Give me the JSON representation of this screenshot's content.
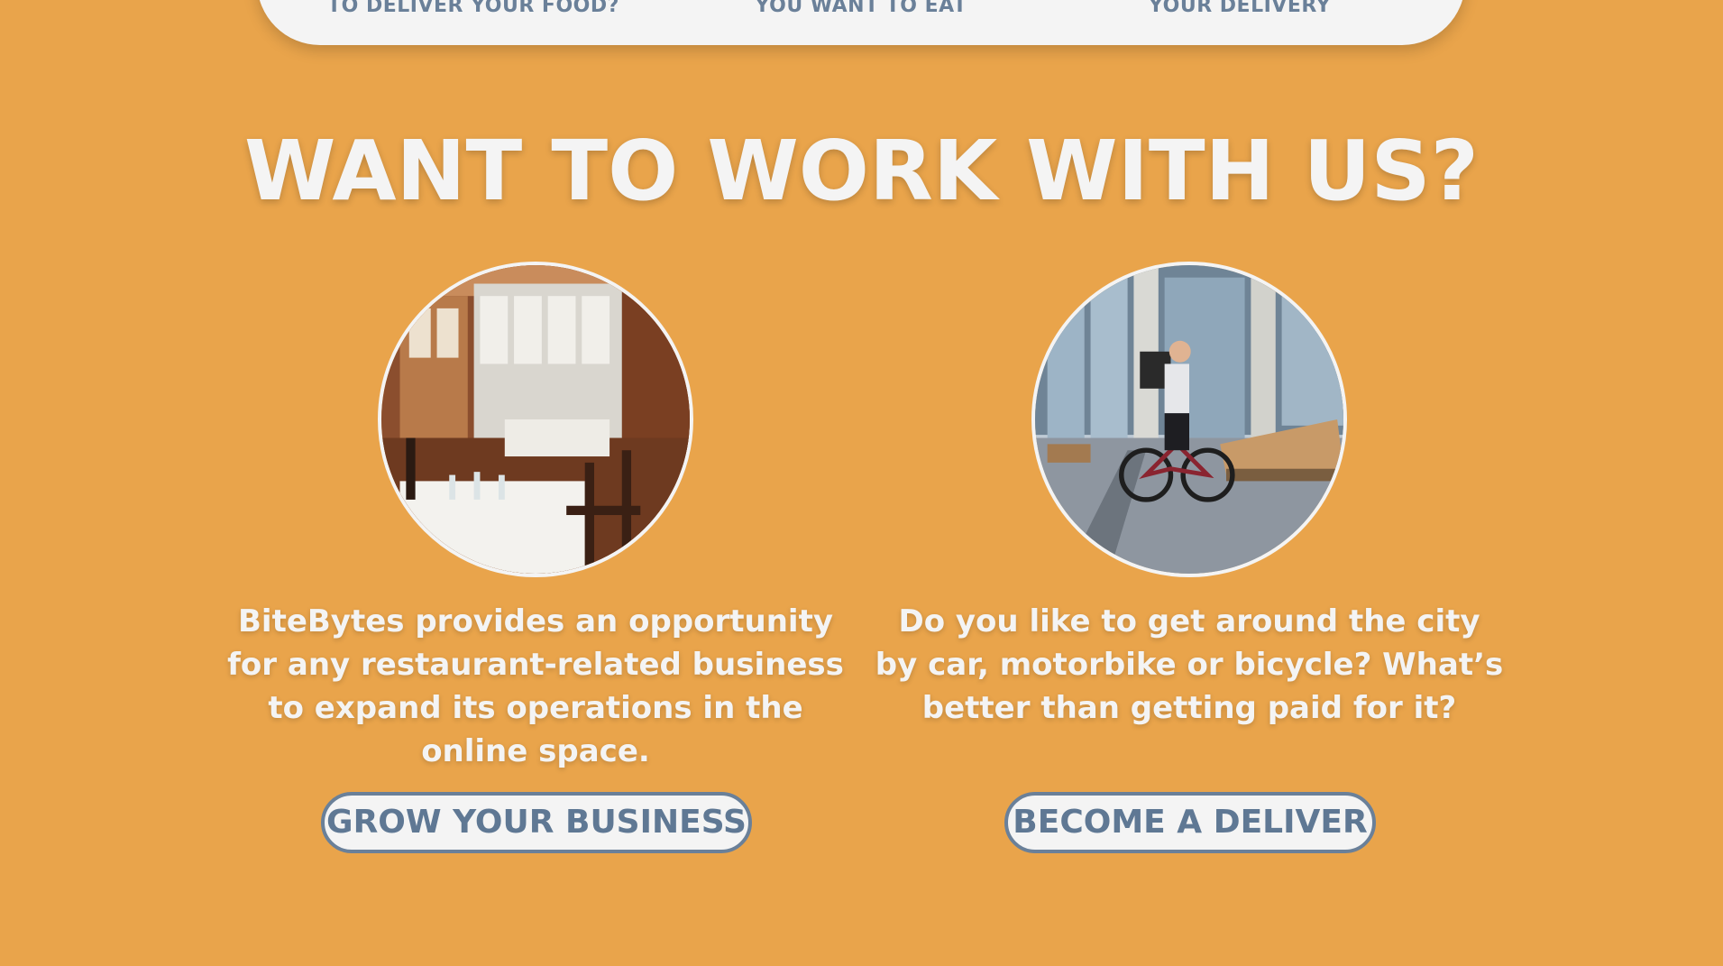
{
  "steps": [
    {
      "label": "TO DELIVER YOUR FOOD?"
    },
    {
      "label": "YOU WANT TO EAT"
    },
    {
      "label": "YOUR DELIVERY"
    }
  ],
  "section": {
    "title": "WANT TO WORK WITH US?"
  },
  "cards": [
    {
      "image": "restaurant-interior-image",
      "text": "BiteBytes provides an opportunity for any restaurant-related business to expand its operations in the online space.",
      "button": "GROW YOUR BUSINESS"
    },
    {
      "image": "bicycle-courier-image",
      "text": "Do you like to get around the city by car, motorbike or bicycle? What’s better than getting paid for it?",
      "button": "BECOME A DELIVER"
    }
  ],
  "colors": {
    "background": "#E9A44B",
    "panel": "#F4F4F4",
    "accent": "#6A8099",
    "text_light": "#F4F4F4"
  }
}
